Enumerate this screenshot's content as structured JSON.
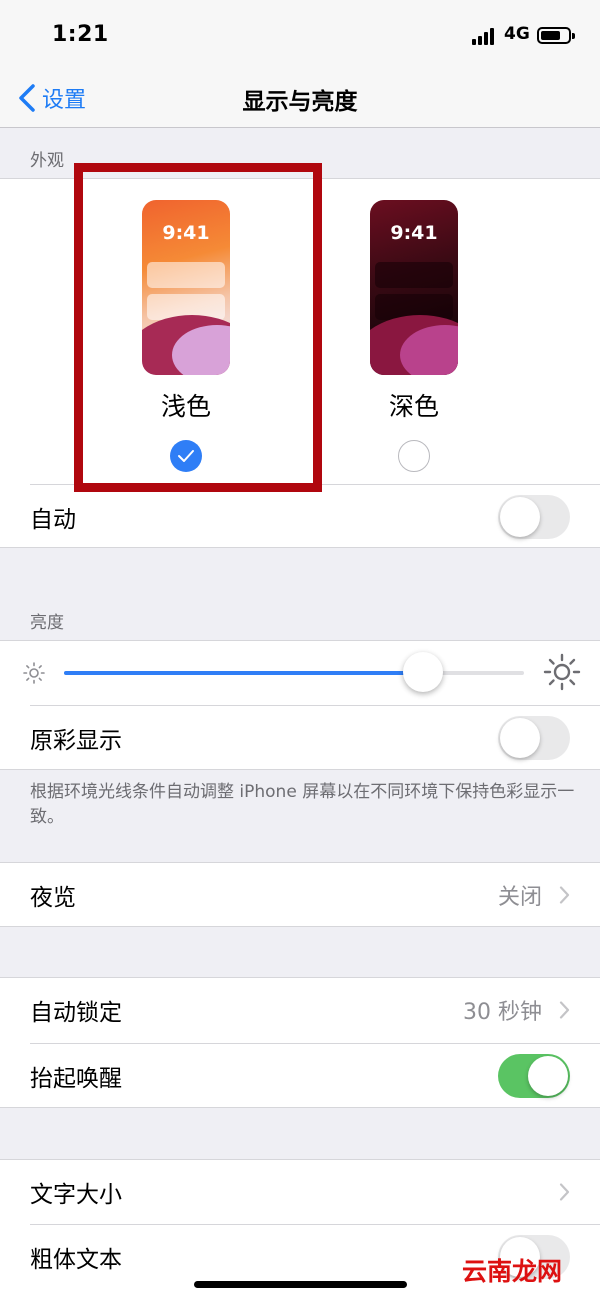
{
  "status_bar": {
    "time": "1:21",
    "network": "4G"
  },
  "nav": {
    "back_label": "设置",
    "title": "显示与亮度"
  },
  "appearance": {
    "header": "外观",
    "options": [
      {
        "preview_time": "9:41",
        "label": "浅色",
        "selected": true
      },
      {
        "preview_time": "9:41",
        "label": "深色",
        "selected": false
      }
    ],
    "auto_label": "自动",
    "auto_on": false
  },
  "brightness": {
    "header": "亮度",
    "level": 0.78,
    "true_tone_label": "原彩显示",
    "true_tone_on": false,
    "true_tone_note": "根据环境光线条件自动调整 iPhone 屏幕以在不同环境下保持色彩显示一致。"
  },
  "night_shift": {
    "label": "夜览",
    "value": "关闭"
  },
  "lock": {
    "auto_lock_label": "自动锁定",
    "auto_lock_value": "30 秒钟",
    "raise_to_wake_label": "抬起唤醒",
    "raise_to_wake_on": true
  },
  "text": {
    "text_size_label": "文字大小",
    "bold_text_label": "粗体文本"
  },
  "watermark": "云南龙网",
  "colors": {
    "accent": "#2f7ef6",
    "toggle_on": "#5ac463",
    "highlight": "#b0070e",
    "link": "#1e7cf5"
  }
}
